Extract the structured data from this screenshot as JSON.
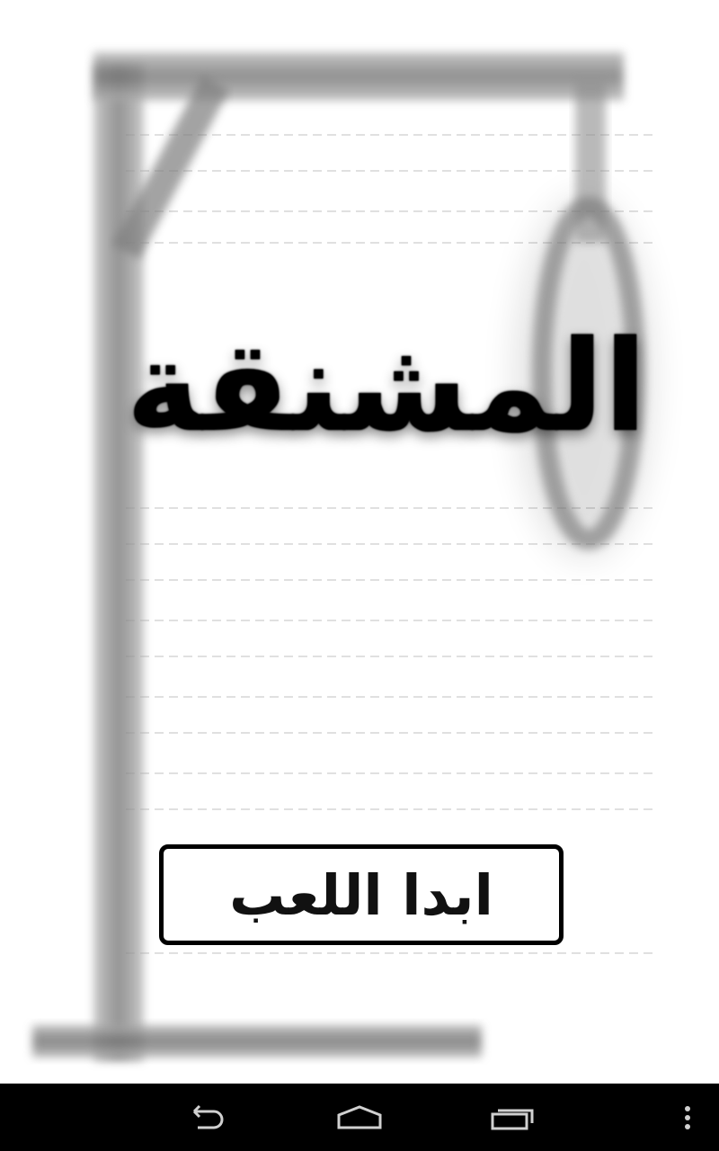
{
  "game": {
    "title": "المشنقة",
    "start_button_label": "ابدا اللعب"
  },
  "navigation_bar": {
    "back_icon": "back-icon",
    "home_icon": "home-icon",
    "recents_icon": "recent-apps-icon",
    "menu_icon": "overflow-menu-icon"
  },
  "colors": {
    "background": "#ffffff",
    "gallows": "#8a8a8a",
    "text": "#000000",
    "nav_bar": "#000000",
    "nav_icons": "#d0d0d0"
  }
}
